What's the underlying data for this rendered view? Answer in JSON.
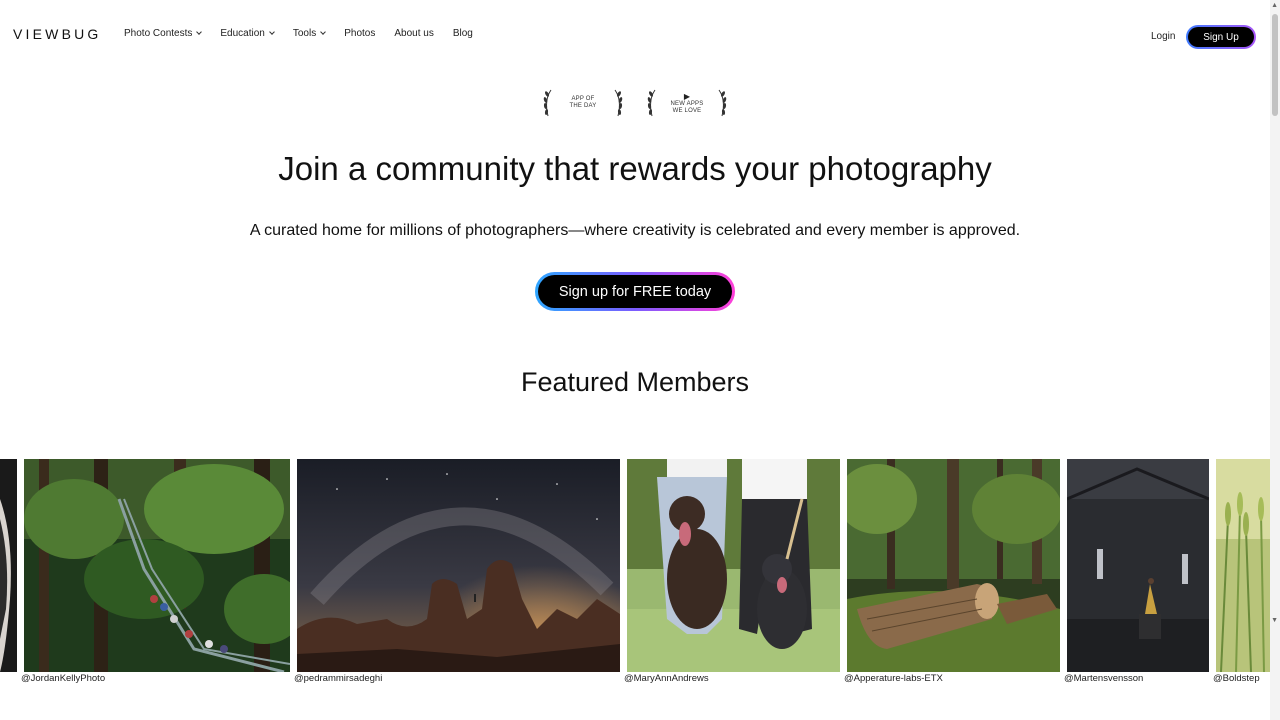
{
  "header": {
    "logo": "VIEWBUG",
    "nav": [
      {
        "label": "Photo Contests",
        "dropdown": true
      },
      {
        "label": "Education",
        "dropdown": true
      },
      {
        "label": "Tools",
        "dropdown": true
      },
      {
        "label": "Photos",
        "dropdown": false
      },
      {
        "label": "About us",
        "dropdown": false
      },
      {
        "label": "Blog",
        "dropdown": false
      }
    ],
    "login": "Login",
    "signup": "Sign Up"
  },
  "badges": [
    {
      "icon": "apple-icon",
      "line1": "APP OF",
      "line2": "THE DAY"
    },
    {
      "icon": "play-store-icon",
      "line1": "NEW APPS",
      "line2": "WE LOVE"
    }
  ],
  "hero": {
    "title": "Join a community that rewards your photography",
    "subtitle": "A curated home for millions of photographers—where creativity is celebrated and every member is approved.",
    "cta": "Sign up for FREE today"
  },
  "featured": {
    "title": "Featured Members",
    "members": [
      {
        "handle": "",
        "scene": "portrait-dark"
      },
      {
        "handle": "@JordanKellyPhoto",
        "scene": "forest-bridge"
      },
      {
        "handle": "@pedrammirsadeghi",
        "scene": "night-sky-rocks"
      },
      {
        "handle": "@MaryAnnAndrews",
        "scene": "dogs-couple"
      },
      {
        "handle": "@Apperature-labs-ETX",
        "scene": "forest-log"
      },
      {
        "handle": "@Martensvensson",
        "scene": "dark-barn"
      },
      {
        "handle": "@Boldstep",
        "scene": "wheat-field"
      }
    ]
  },
  "colors": {
    "accent_blue": "#3f7bff",
    "accent_pink": "#ff3fd8",
    "text": "#111111"
  }
}
